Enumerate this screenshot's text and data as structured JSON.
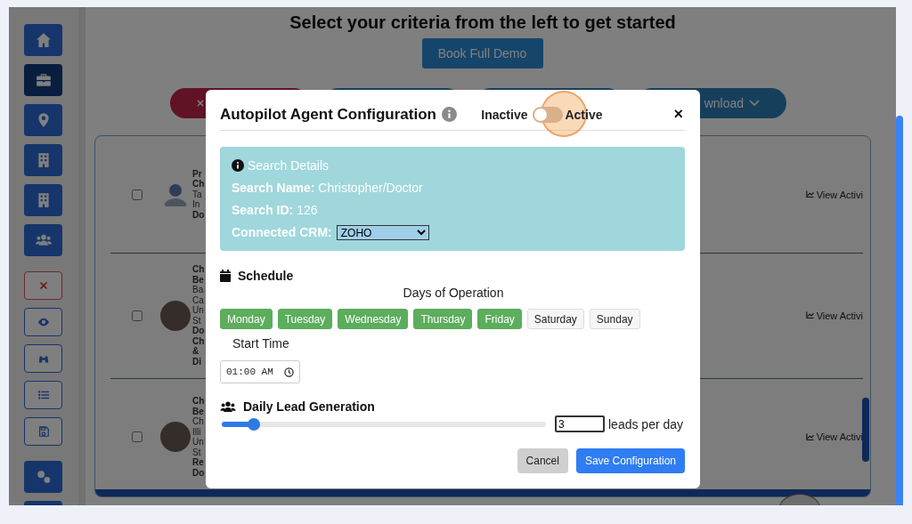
{
  "sidebar": {
    "items": [
      {
        "kind": "filled",
        "selected": false
      },
      {
        "kind": "filled",
        "selected": true
      },
      {
        "kind": "filled",
        "selected": false
      },
      {
        "kind": "filled",
        "selected": false
      },
      {
        "kind": "filled",
        "selected": false
      },
      {
        "kind": "filled",
        "selected": false
      },
      {
        "kind": "danger",
        "selected": false
      },
      {
        "kind": "outline",
        "selected": false
      },
      {
        "kind": "outline",
        "selected": false
      },
      {
        "kind": "outline",
        "selected": false
      },
      {
        "kind": "outline",
        "selected": false
      },
      {
        "kind": "filled",
        "selected": false
      },
      {
        "kind": "filled",
        "selected": false
      }
    ]
  },
  "page_title": "Select your criteria from the left to get started",
  "demo_button": "Book Full Demo",
  "filter_buttons": [
    {
      "kind": "clear"
    },
    {
      "kind": "plain"
    },
    {
      "kind": "plain"
    },
    {
      "kind": "download",
      "label": "wnload"
    }
  ],
  "results": [
    {
      "checked": false,
      "kind": "silhouette",
      "lines": [
        {
          "text": "Pr",
          "bold": true
        },
        {
          "text": "Ch",
          "bold": true
        },
        {
          "text": "Ta",
          "bold": false
        },
        {
          "text": "In",
          "bold": false
        },
        {
          "text": "Do",
          "bold": true
        }
      ],
      "action": "View Activi"
    },
    {
      "checked": false,
      "kind": "photo",
      "lines": [
        {
          "text": "Ch",
          "bold": true
        },
        {
          "text": "Be",
          "bold": true
        },
        {
          "text": "Ba",
          "bold": false
        },
        {
          "text": "Ca",
          "bold": false
        },
        {
          "text": "Un",
          "bold": false
        },
        {
          "text": "St",
          "bold": false
        },
        {
          "text": "Do",
          "bold": true
        },
        {
          "text": "Ch",
          "bold": true
        },
        {
          "text": "&",
          "bold": true
        },
        {
          "text": "Di",
          "bold": true
        }
      ],
      "action": "View Activi"
    },
    {
      "checked": false,
      "kind": "photo",
      "lines": [
        {
          "text": "Ch",
          "bold": true
        },
        {
          "text": "Be",
          "bold": true
        },
        {
          "text": "Ch",
          "bold": false
        },
        {
          "text": "Illi",
          "bold": false
        },
        {
          "text": "Un",
          "bold": false
        },
        {
          "text": "St",
          "bold": false
        },
        {
          "text": "Re",
          "bold": true
        },
        {
          "text": "Do",
          "bold": true
        }
      ],
      "action": "View Activi"
    }
  ],
  "modal": {
    "title": "Autopilot Agent Configuration",
    "inactive_label": "Inactive",
    "active_label": "Active",
    "active": false,
    "close": "×",
    "search_details": {
      "heading": "Search Details",
      "fields": [
        {
          "label": "Search Name:",
          "value": "Christopher/Doctor"
        },
        {
          "label": "Search ID:",
          "value": "126"
        }
      ],
      "crm_label": "Connected CRM:",
      "crm_value": "ZOHO"
    },
    "schedule": {
      "heading": "Schedule",
      "days_heading": "Days of Operation",
      "days": [
        {
          "label": "Monday",
          "selected": true
        },
        {
          "label": "Tuesday",
          "selected": true
        },
        {
          "label": "Wednesday",
          "selected": true
        },
        {
          "label": "Thursday",
          "selected": true
        },
        {
          "label": "Friday",
          "selected": true
        },
        {
          "label": "Saturday",
          "selected": false
        },
        {
          "label": "Sunday",
          "selected": false
        }
      ],
      "start_time_label": "Start Time",
      "start_time": "01:00 AM"
    },
    "leads": {
      "heading": "Daily Lead Generation",
      "level": 0.1,
      "value": "3",
      "unit": "leads per day"
    },
    "buttons": [
      {
        "label": "Cancel",
        "kind": "secondary"
      },
      {
        "label": "Save Configuration",
        "kind": "primary"
      }
    ]
  }
}
